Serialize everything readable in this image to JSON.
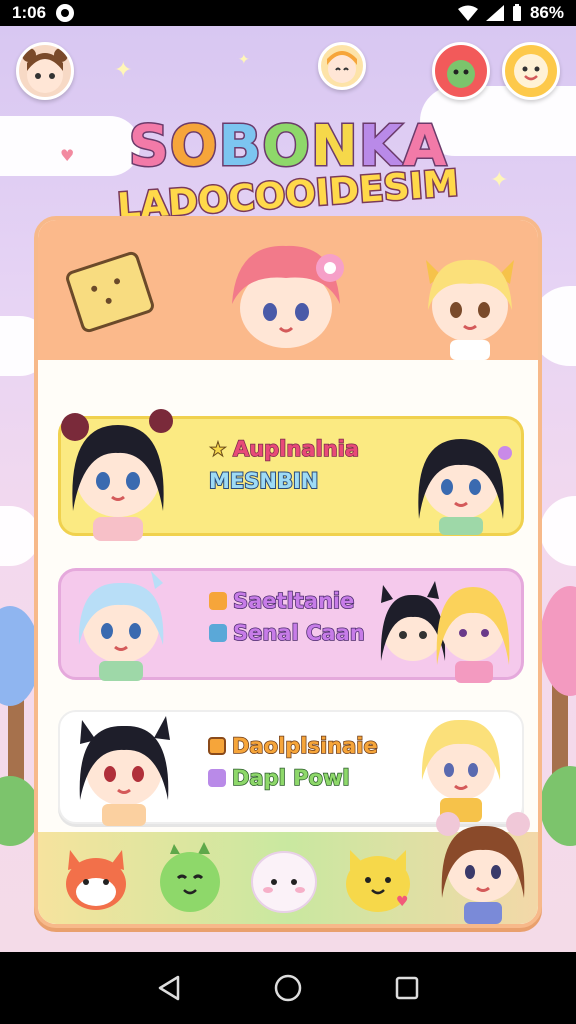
{
  "status_bar": {
    "time": "1:06",
    "battery_text": "86%"
  },
  "title": {
    "line1": [
      "S",
      "O",
      "B",
      "O",
      "N",
      "K",
      "A"
    ],
    "line1_colors": [
      "#f27aa8",
      "#f6a53a",
      "#7cc5f0",
      "#8ed86a",
      "#f6d84a",
      "#b98ae8",
      "#f27aa8"
    ],
    "line2": "LADOCOOIDESIM"
  },
  "cards": [
    {
      "line1": "Auplnalnia",
      "line1_icon": "star-icon",
      "line2": "MESNBIN"
    },
    {
      "line1": "Saetltanie",
      "line1_icon": "heart-icon",
      "line2": "Senal Caan",
      "line2_icon": "bookmark-icon"
    },
    {
      "line1": "Daolplsinaie",
      "line1_icon": "book-icon",
      "line2": "Dapl Powl",
      "line2_icon": "trophy-icon"
    }
  ],
  "colors": {
    "sky_top": "#d8c7f2",
    "panel_header": "#fbb98b",
    "card_yellow": "#fbea82",
    "card_pink": "#f5c9ec"
  },
  "nav": {
    "back_icon": "back-triangle-icon",
    "home_icon": "home-circle-icon",
    "recents_icon": "recents-square-icon"
  }
}
